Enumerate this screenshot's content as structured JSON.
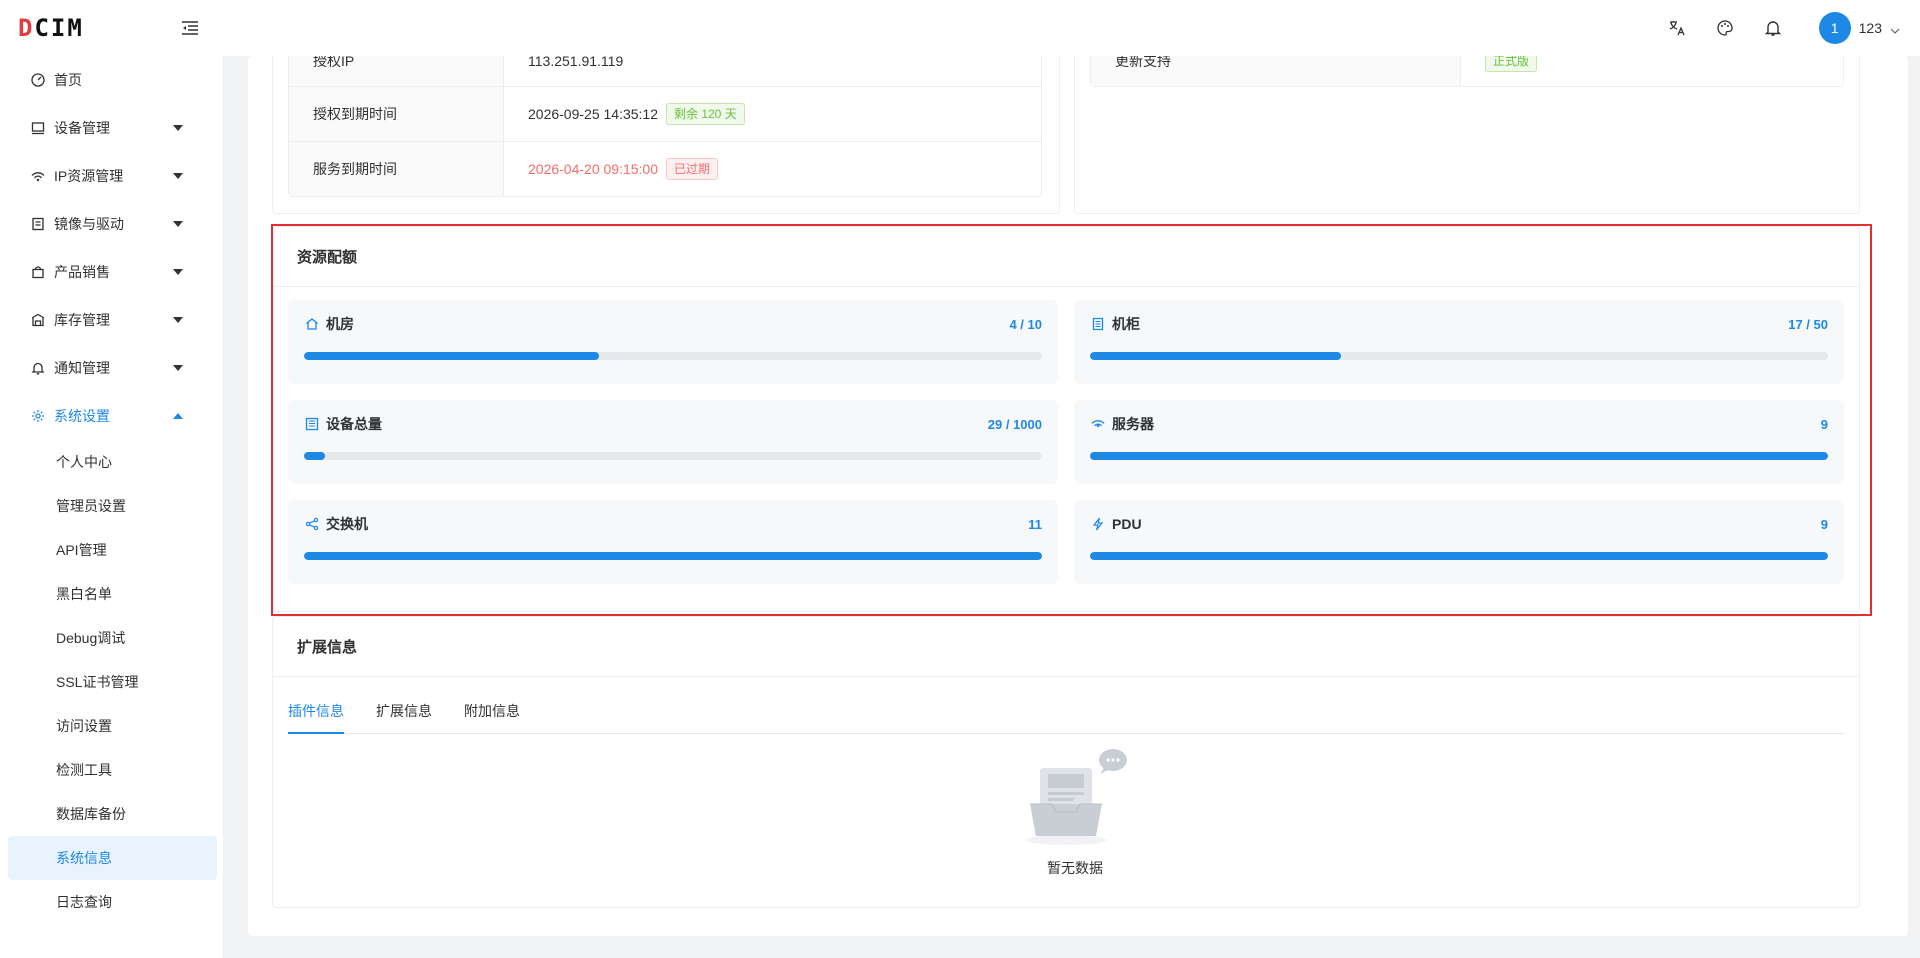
{
  "app": {
    "logo": "DCIM"
  },
  "header": {
    "avatar_initial": "1",
    "username": "123"
  },
  "sidebar": {
    "items": [
      {
        "label": "首页",
        "icon": "dashboard-icon",
        "expandable": false
      },
      {
        "label": "设备管理",
        "icon": "monitor-icon",
        "expandable": true
      },
      {
        "label": "IP资源管理",
        "icon": "network-icon",
        "expandable": true
      },
      {
        "label": "镜像与驱动",
        "icon": "document-icon",
        "expandable": true
      },
      {
        "label": "产品销售",
        "icon": "bag-icon",
        "expandable": true
      },
      {
        "label": "库存管理",
        "icon": "warehouse-icon",
        "expandable": true
      },
      {
        "label": "通知管理",
        "icon": "bell-icon",
        "expandable": true
      },
      {
        "label": "系统设置",
        "icon": "gear-icon",
        "expandable": true,
        "expanded": true
      }
    ],
    "sub_items": [
      {
        "label": "个人中心"
      },
      {
        "label": "管理员设置"
      },
      {
        "label": "API管理"
      },
      {
        "label": "黑白名单"
      },
      {
        "label": "Debug调试"
      },
      {
        "label": "SSL证书管理"
      },
      {
        "label": "访问设置"
      },
      {
        "label": "检测工具"
      },
      {
        "label": "数据库备份"
      },
      {
        "label": "系统信息",
        "active": true
      },
      {
        "label": "日志查询"
      }
    ]
  },
  "license": {
    "rows": [
      {
        "label": "授权IP",
        "value": "113.251.91.119"
      },
      {
        "label": "授权到期时间",
        "value": "2026-09-25 14:35:12",
        "tag": "剩余 120 天"
      },
      {
        "label": "服务到期时间",
        "value": "2026-04-20 09:15:00",
        "tag": "已过期"
      }
    ],
    "right_rows": [
      {
        "label": "更新支持",
        "tag": "正式版"
      }
    ]
  },
  "quota": {
    "title": "资源配额",
    "items": [
      {
        "label": "机房",
        "icon": "home-icon",
        "value_text": "4 / 10",
        "percent": 40
      },
      {
        "label": "机柜",
        "icon": "cabinet-icon",
        "value_text": "17 / 50",
        "percent": 34
      },
      {
        "label": "设备总量",
        "icon": "building-icon",
        "value_text": "29 / 1000",
        "percent": 2.9
      },
      {
        "label": "服务器",
        "icon": "server-icon",
        "value_text": "9",
        "percent": 100
      },
      {
        "label": "交换机",
        "icon": "share-icon",
        "value_text": "11",
        "percent": 100
      },
      {
        "label": "PDU",
        "icon": "lightning-icon",
        "value_text": "9",
        "percent": 100
      }
    ]
  },
  "extension": {
    "title": "扩展信息",
    "tabs": [
      {
        "label": "插件信息",
        "active": true
      },
      {
        "label": "扩展信息"
      },
      {
        "label": "附加信息"
      }
    ],
    "empty_text": "暂无数据"
  },
  "colors": {
    "primary": "#1e88e5",
    "danger": "#f56c6c",
    "success": "#67c23a",
    "highlight_border": "#e03131"
  }
}
